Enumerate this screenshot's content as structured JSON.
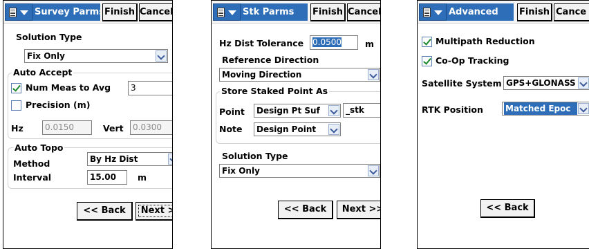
{
  "screens": [
    {
      "title": "Survey Parms",
      "finish_label": "Finish",
      "cancel_label": "Cancel",
      "solution_type_label": "Solution Type",
      "solution_type_value": "Fix Only",
      "auto_accept_label": "Auto Accept",
      "num_meas_label": "Num Meas to Avg",
      "num_meas_value": "3",
      "num_meas_checked": true,
      "precision_label": "Precision (m)",
      "precision_checked": false,
      "hz_label": "Hz",
      "hz_value": "0.0150",
      "vert_label": "Vert",
      "vert_value": "0.0300",
      "auto_topo_label": "Auto Topo",
      "method_label": "Method",
      "method_value": "By Hz Dist",
      "interval_label": "Interval",
      "interval_value": "15.00",
      "interval_unit": "m",
      "back_label": "<< Back",
      "next_label": "Next >>"
    },
    {
      "title": "Stk Parms",
      "finish_label": "Finish",
      "cancel_label": "Cancel",
      "hz_tol_label": "Hz Dist Tolerance",
      "hz_tol_value": "0.0500",
      "hz_tol_unit": "m",
      "ref_dir_label": "Reference Direction",
      "ref_dir_value": "Moving Direction",
      "store_as_label": "Store Staked Point As",
      "point_label": "Point",
      "point_value": "Design Pt Suf",
      "suffix_value": "_stk",
      "note_label": "Note",
      "note_value": "Design Point",
      "solution_type_label": "Solution Type",
      "solution_type_value": "Fix Only",
      "back_label": "<< Back",
      "next_label": "Next >>"
    },
    {
      "title": "Advanced",
      "finish_label": "Finish",
      "cancel_label": "Cance",
      "multipath_label": "Multipath Reduction",
      "multipath_checked": true,
      "coop_label": "Co-Op Tracking",
      "coop_checked": true,
      "sat_sys_label": "Satellite System",
      "sat_sys_value": "GPS+GLONASS",
      "rtk_label": "RTK Position",
      "rtk_value": "Matched Epoc",
      "back_label": "<< Back"
    }
  ],
  "colors": {
    "title_bar": "#2e6eb8",
    "check_mark": "#1a8a2a",
    "selection": "#2e6eb8"
  },
  "icons": {
    "menu": "document-menu-icon",
    "dropdown": "chevron-down-icon",
    "check": "checkmark-icon"
  }
}
